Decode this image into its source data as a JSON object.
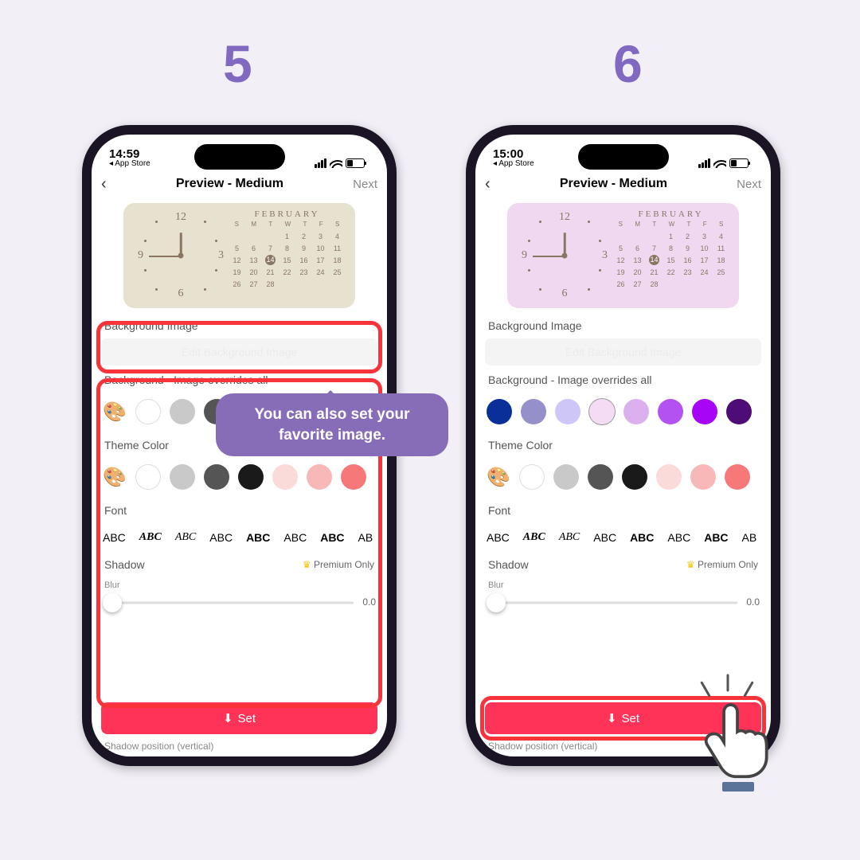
{
  "steps": {
    "s5": "5",
    "s6": "6"
  },
  "status": {
    "time5": "14:59",
    "time6": "15:00",
    "back": "◂ App Store"
  },
  "nav": {
    "title": "Preview - Medium",
    "next": "Next"
  },
  "widget": {
    "month": "FEBRUARY",
    "dow": [
      "S",
      "M",
      "T",
      "W",
      "T",
      "F",
      "S"
    ],
    "weeks": [
      [
        "",
        "",
        "",
        "1",
        "2",
        "3",
        "4"
      ],
      [
        "5",
        "6",
        "7",
        "8",
        "9",
        "10",
        "11"
      ],
      [
        "12",
        "13",
        "14",
        "15",
        "16",
        "17",
        "18"
      ],
      [
        "19",
        "20",
        "21",
        "22",
        "23",
        "24",
        "25"
      ],
      [
        "26",
        "27",
        "28",
        "",
        "",
        "",
        ""
      ]
    ],
    "highlight": "14",
    "clock": {
      "h12": "12",
      "h3": "3",
      "h6": "6",
      "h9": "9"
    }
  },
  "labels": {
    "bgimg": "Background Image",
    "editbg": "Edit Background Image",
    "bgcolor": "Background - Image overrides all",
    "theme": "Theme Color",
    "font": "Font",
    "shadow": "Shadow",
    "premium": "Premium Only",
    "blur": "Blur",
    "blurval": "0.0",
    "set": "Set",
    "shpos": "Shadow position (vertical)"
  },
  "colors5_bg": [
    "#ffffff",
    "#c9c9c9",
    "#555555",
    "#1a1a1a",
    "#fbdada",
    "#f9b8b8",
    "#f67878"
  ],
  "colors6_bg": [
    "#0a2f99",
    "#9590c9",
    "#cdc6f6",
    "#f3dcf4",
    "#dcafee",
    "#b352f0",
    "#a706f6",
    "#4e0c77"
  ],
  "colors6_bg_sel": 3,
  "theme_colors": [
    "#ffffff",
    "#c9c9c9",
    "#555555",
    "#1a1a1a",
    "#fbdada",
    "#f9b8b8",
    "#f67878"
  ],
  "fonts": [
    "ABC",
    "ABC",
    "ABC",
    "ABC",
    "ABC",
    "ABC",
    "ABC",
    "AB"
  ],
  "tooltip": "You can also set your favorite image."
}
